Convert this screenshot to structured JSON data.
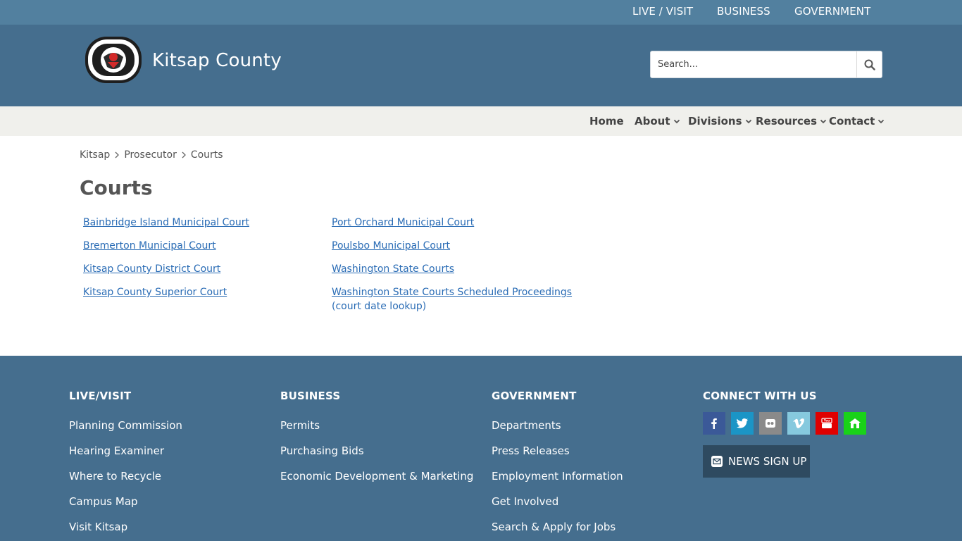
{
  "utility_nav": [
    "LIVE / VISIT",
    "BUSINESS",
    "GOVERNMENT"
  ],
  "site": {
    "title": "Kitsap County",
    "logo_alt": "Kitsap County seal",
    "logo_text_top": "KITSAP COUNTY",
    "logo_text_bottom": "WASHINGTON",
    "logo_year_left": "18",
    "logo_year_right": "57"
  },
  "search": {
    "placeholder": "Search..."
  },
  "main_nav": [
    {
      "label": "Home",
      "has_dropdown": false
    },
    {
      "label": "About",
      "has_dropdown": true
    },
    {
      "label": "Divisions",
      "has_dropdown": true
    },
    {
      "label": "Resources",
      "has_dropdown": true
    },
    {
      "label": "Contact",
      "has_dropdown": true
    }
  ],
  "breadcrumb": [
    "Kitsap",
    "Prosecutor",
    "Courts"
  ],
  "page_title": "Courts",
  "courts_left": [
    "Bainbridge Island Municipal Court",
    "Bremerton Municipal Court",
    "Kitsap County District Court",
    "Kitsap County Superior Court"
  ],
  "courts_right": [
    "Port Orchard Municipal Court",
    "Poulsbo Municipal Court",
    "Washington State Courts",
    "Washington State Courts Scheduled Proceedings",
    "(court date lookup)"
  ],
  "footer": {
    "live_visit": {
      "heading": "LIVE/VISIT",
      "links": [
        "Planning Commission",
        "Hearing Examiner",
        "Where to Recycle",
        "Campus Map",
        "Visit Kitsap"
      ]
    },
    "business": {
      "heading": "BUSINESS",
      "links": [
        "Permits",
        "Purchasing Bids",
        "Economic Development & Marketing"
      ]
    },
    "government": {
      "heading": "GOVERNMENT",
      "links": [
        "Departments",
        "Press Releases",
        "Employment Information",
        "Get Involved",
        "Search & Apply for Jobs"
      ]
    },
    "connect": {
      "heading": "CONNECT WITH US",
      "news_signup": "NEWS SIGN UP"
    }
  },
  "colors": {
    "utility_bar": "#52809f",
    "header": "#456e8e",
    "nav_bar": "#f0f0ec",
    "link": "#2a6cb5",
    "facebook": "#3b5998",
    "twitter": "#1b95c6",
    "flickr": "#8a8a8a",
    "vimeo": "#86c9de",
    "youtube": "#e00000",
    "nextdoor": "#19d219"
  }
}
